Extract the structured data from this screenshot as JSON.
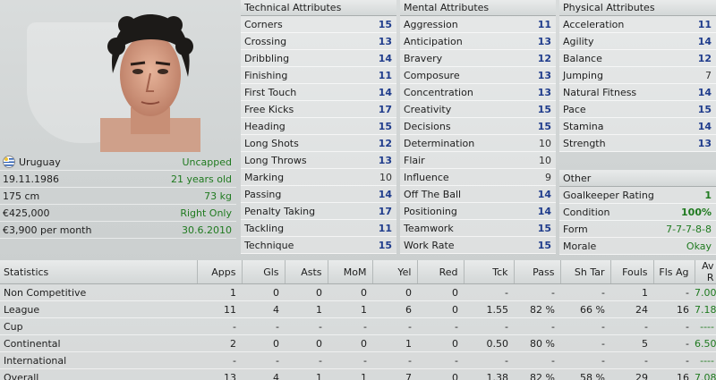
{
  "profile": {
    "nationality": "Uruguay",
    "caps": "Uncapped",
    "dob": "19.11.1986",
    "age": "21 years old",
    "height": "175 cm",
    "weight": "73 kg",
    "value": "€425,000",
    "foot": "Right Only",
    "wage": "€3,900 per month",
    "contract_end": "30.6.2010"
  },
  "technical": {
    "title": "Technical Attributes",
    "items": [
      {
        "label": "Corners",
        "value": "15"
      },
      {
        "label": "Crossing",
        "value": "13"
      },
      {
        "label": "Dribbling",
        "value": "14"
      },
      {
        "label": "Finishing",
        "value": "11"
      },
      {
        "label": "First Touch",
        "value": "14"
      },
      {
        "label": "Free Kicks",
        "value": "17"
      },
      {
        "label": "Heading",
        "value": "15"
      },
      {
        "label": "Long Shots",
        "value": "12"
      },
      {
        "label": "Long Throws",
        "value": "13"
      },
      {
        "label": "Marking",
        "value": "10"
      },
      {
        "label": "Passing",
        "value": "14"
      },
      {
        "label": "Penalty Taking",
        "value": "17"
      },
      {
        "label": "Tackling",
        "value": "11"
      },
      {
        "label": "Technique",
        "value": "15"
      }
    ]
  },
  "mental": {
    "title": "Mental Attributes",
    "items": [
      {
        "label": "Aggression",
        "value": "11"
      },
      {
        "label": "Anticipation",
        "value": "13"
      },
      {
        "label": "Bravery",
        "value": "12"
      },
      {
        "label": "Composure",
        "value": "13"
      },
      {
        "label": "Concentration",
        "value": "13"
      },
      {
        "label": "Creativity",
        "value": "15"
      },
      {
        "label": "Decisions",
        "value": "15"
      },
      {
        "label": "Determination",
        "value": "10"
      },
      {
        "label": "Flair",
        "value": "10"
      },
      {
        "label": "Influence",
        "value": "9"
      },
      {
        "label": "Off The Ball",
        "value": "14"
      },
      {
        "label": "Positioning",
        "value": "14"
      },
      {
        "label": "Teamwork",
        "value": "15"
      },
      {
        "label": "Work Rate",
        "value": "15"
      }
    ]
  },
  "physical": {
    "title": "Physical Attributes",
    "items": [
      {
        "label": "Acceleration",
        "value": "11"
      },
      {
        "label": "Agility",
        "value": "14"
      },
      {
        "label": "Balance",
        "value": "12"
      },
      {
        "label": "Jumping",
        "value": "7"
      },
      {
        "label": "Natural Fitness",
        "value": "14"
      },
      {
        "label": "Pace",
        "value": "15"
      },
      {
        "label": "Stamina",
        "value": "14"
      },
      {
        "label": "Strength",
        "value": "13"
      }
    ]
  },
  "other": {
    "title": "Other",
    "items": [
      {
        "label": "Goalkeeper Rating",
        "value": "1"
      },
      {
        "label": "Condition",
        "value": "100%"
      },
      {
        "label": "Form",
        "value": "7-7-7-8-8"
      },
      {
        "label": "Morale",
        "value": "Okay"
      }
    ]
  },
  "stats": {
    "headers": [
      "Statistics",
      "Apps",
      "Gls",
      "Asts",
      "MoM",
      "Yel",
      "Red",
      "Tck",
      "Pass",
      "Sh Tar",
      "Fouls",
      "Fls Ag",
      "Av R"
    ],
    "rows": [
      [
        "Non Competitive",
        "1",
        "0",
        "0",
        "0",
        "0",
        "0",
        "-",
        "-",
        "-",
        "1",
        "-",
        "7.00"
      ],
      [
        "League",
        "11",
        "4",
        "1",
        "1",
        "6",
        "0",
        "1.55",
        "82 %",
        "66 %",
        "24",
        "16",
        "7.18"
      ],
      [
        "Cup",
        "-",
        "-",
        "-",
        "-",
        "-",
        "-",
        "-",
        "-",
        "-",
        "-",
        "-",
        "----"
      ],
      [
        "Continental",
        "2",
        "0",
        "0",
        "0",
        "1",
        "0",
        "0.50",
        "80 %",
        "-",
        "5",
        "-",
        "6.50"
      ],
      [
        "International",
        "-",
        "-",
        "-",
        "-",
        "-",
        "-",
        "-",
        "-",
        "-",
        "-",
        "-",
        "----"
      ],
      [
        "Overall",
        "13",
        "4",
        "1",
        "1",
        "7",
        "0",
        "1.38",
        "82 %",
        "58 %",
        "29",
        "16",
        "7.08"
      ]
    ]
  }
}
